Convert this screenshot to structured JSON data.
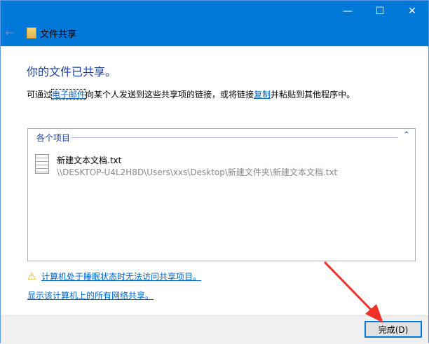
{
  "window": {
    "title": "文件共享",
    "minimize": "—",
    "maximize": "☐",
    "close": "✕",
    "back": "←"
  },
  "main": {
    "heading": "你的文件已共享。",
    "desc_pre": "可通过",
    "email_link": "电子邮件",
    "desc_mid": "向某个人发送到这些共享项的链接，或将链接",
    "copy_link": "复制",
    "desc_post": "并粘贴到其他程序中。"
  },
  "list": {
    "group": "各个项目",
    "collapse": "⌃",
    "items": [
      {
        "name": "新建文本文档.txt",
        "path": "\\\\DESKTOP-U4L2H8D\\Users\\xxs\\Desktop\\新建文件夹\\新建文本文档.txt"
      }
    ]
  },
  "links": {
    "warning": "计算机处于睡眠状态时无法访问共享项目。",
    "show_all": "显示该计算机上的所有网络共享。"
  },
  "footer": {
    "done": "完成(D)"
  },
  "colors": {
    "accent": "#0078d7",
    "arrow": "#f0302a"
  }
}
